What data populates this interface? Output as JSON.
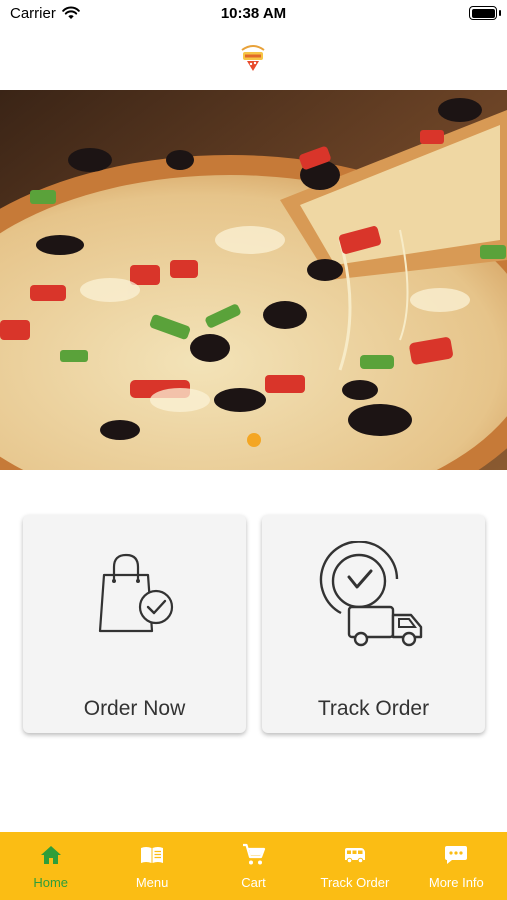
{
  "status_bar": {
    "carrier": "Carrier",
    "time": "10:38 AM"
  },
  "header": {
    "logo_icon": "pizza-logo-icon"
  },
  "hero": {
    "image": "pizza-photo",
    "pager": {
      "count": 1,
      "active": 0
    }
  },
  "actions": [
    {
      "label": "Order Now",
      "icon": "shopping-bag-check-icon"
    },
    {
      "label": "Track Order",
      "icon": "clock-truck-icon"
    }
  ],
  "tab_bar": {
    "background": "#fbbd14",
    "active_color": "#2e9e3a",
    "items": [
      {
        "label": "Home",
        "icon": "home-icon",
        "active": true
      },
      {
        "label": "Menu",
        "icon": "menu-book-icon",
        "active": false
      },
      {
        "label": "Cart",
        "icon": "cart-icon",
        "active": false
      },
      {
        "label": "Track Order",
        "icon": "van-icon",
        "active": false
      },
      {
        "label": "More Info",
        "icon": "chat-icon",
        "active": false
      }
    ]
  }
}
